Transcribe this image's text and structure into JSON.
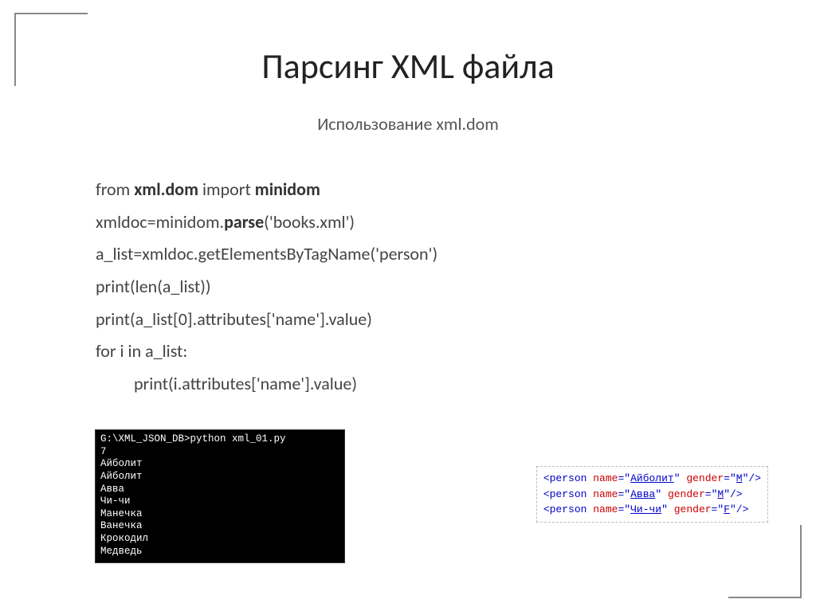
{
  "title": "Парсинг XML файла",
  "subtitle": "Использование xml.dom",
  "code": {
    "l1a": "from ",
    "l1b": "xml.dom",
    "l1c": " import ",
    "l1d": "minidom",
    "l2a": "xmldoc=minidom.",
    "l2b": "parse",
    "l2c": "('books.xml')",
    "l3": "a_list=xmldoc.getElementsByTagName('person')",
    "l4": "print(len(a_list))",
    "l5": "print(a_list[0].attributes['name'].value)",
    "l6": "for i in a_list:",
    "l7": "print(i.attributes['name'].value)"
  },
  "terminal": {
    "prompt": "G:\\XML_JSON_DB>python xml_01.py",
    "lines": [
      "7",
      "Айболит",
      "Айболит",
      "Авва",
      "Чи-чи",
      "Манечка",
      "Ванечка",
      "Крокодил",
      "Медведь"
    ]
  },
  "xml": {
    "rows": [
      {
        "tag": "person",
        "attrs": [
          {
            "name": "name",
            "val": "Айболит"
          },
          {
            "name": "gender",
            "val": "M"
          }
        ]
      },
      {
        "tag": "person",
        "attrs": [
          {
            "name": "name",
            "val": "Авва"
          },
          {
            "name": "gender",
            "val": "M"
          }
        ]
      },
      {
        "tag": "person",
        "attrs": [
          {
            "name": "name",
            "val": "Чи-чи"
          },
          {
            "name": "gender",
            "val": "F"
          }
        ]
      }
    ]
  }
}
